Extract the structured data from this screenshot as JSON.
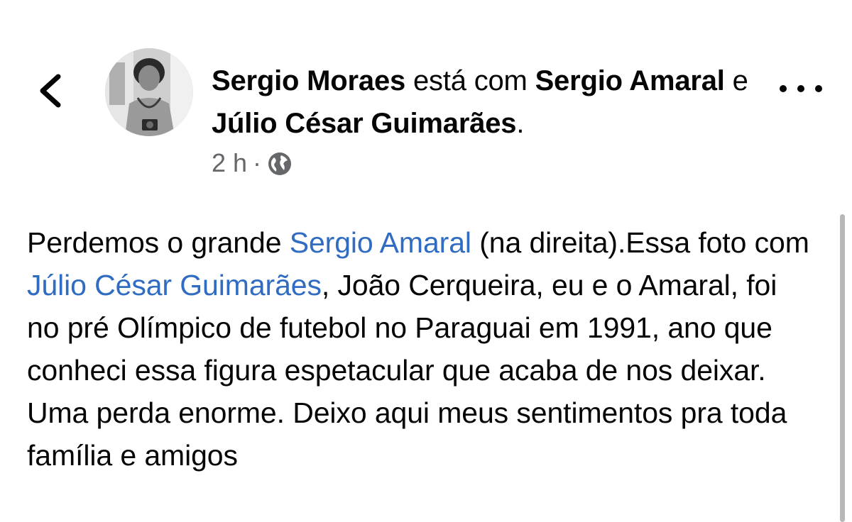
{
  "nav": {
    "back_icon": "chevron-left-icon",
    "more_icon": "more-horizontal-icon"
  },
  "author": {
    "avatar_icon": "avatar-photo",
    "name": "Sergio Moraes",
    "connector": "está com",
    "tag1": "Sergio Amaral",
    "and_text": "e",
    "tag2": "Júlio César Guimarães",
    "period": "."
  },
  "meta": {
    "time": "2 h",
    "separator": "·",
    "privacy_icon": "globe-icon"
  },
  "post": {
    "seg1": "Perdemos o grande ",
    "mention1": "Sergio Amaral",
    "seg2": " (na direita).Essa foto com ",
    "mention2": "Júlio César Guimarães",
    "seg3": ", João Cerqueira, eu e o Amaral, foi no pré Olímpico de futebol no Paraguai em 1991, ano que conheci essa figura espetacular que acaba de nos deixar. Uma perda enorme. Deixo aqui meus sentimentos pra toda família e amigos"
  },
  "colors": {
    "text": "#050505",
    "secondary": "#65676b",
    "link": "#2f6cc2"
  }
}
